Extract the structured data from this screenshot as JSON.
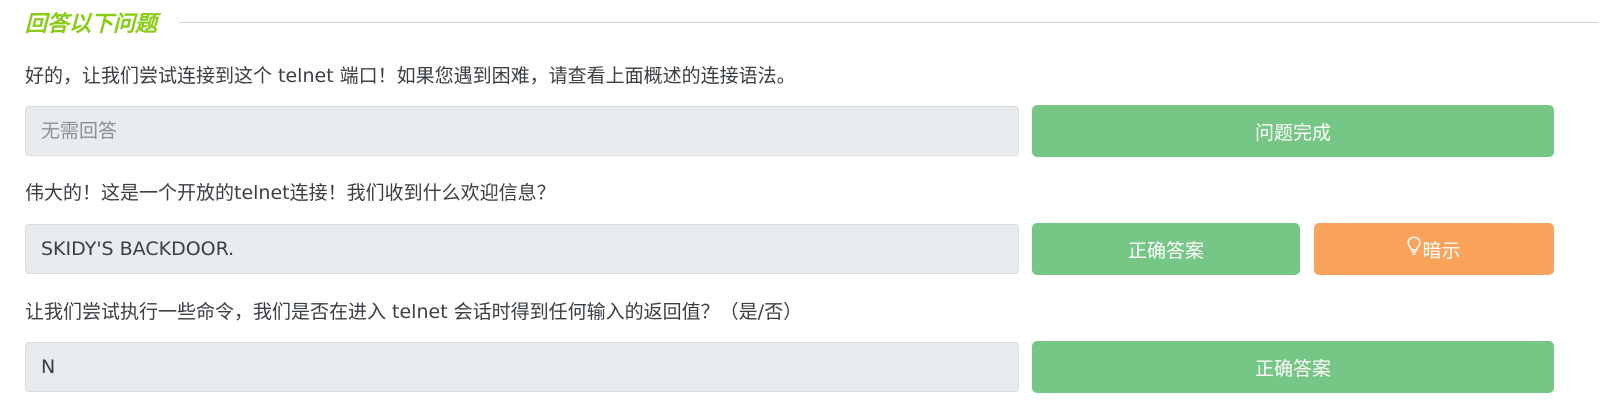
{
  "section": {
    "title": "回答以下问题"
  },
  "questions": [
    {
      "text": "好的，让我们尝试连接到这个 telnet 端口！如果您遇到困难，请查看上面概述的连接语法。",
      "answer_value": "",
      "answer_placeholder": "无需回答",
      "button_label": "问题完成"
    },
    {
      "text": "伟大的！这是一个开放的telnet连接！我们收到什么欢迎信息？",
      "answer_value": "SKIDY'S BACKDOOR.",
      "answer_placeholder": "",
      "button_label": "正确答案",
      "hint_label": "暗示",
      "hint_icon": "lightbulb-icon"
    },
    {
      "text": "让我们尝试执行一些命令，我们是否在进入 telnet 会话时得到任何输入的返回值？（是/否）",
      "answer_value": "N",
      "answer_placeholder": "",
      "button_label": "正确答案"
    }
  ],
  "colors": {
    "title": "#88cc14",
    "success_button": "#76c785",
    "hint_button": "#fca35b",
    "input_background": "#e9ecef"
  }
}
